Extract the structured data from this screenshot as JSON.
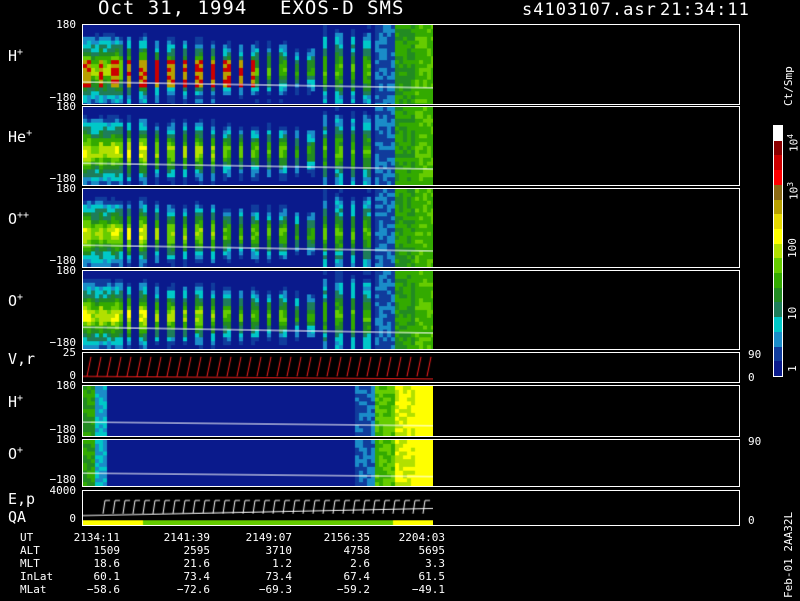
{
  "header": {
    "date": "Oct 31, 1994",
    "instrument": "EXOS-D SMS",
    "file": "s4103107.asr",
    "time": "21:34:11"
  },
  "colorbar": {
    "unit": "Ct/Smp",
    "labels": [
      "10",
      "10",
      "100",
      "10",
      "1"
    ],
    "label_sup": [
      "4",
      "3",
      "",
      "",
      ""
    ],
    "colors": [
      "#ffffff",
      "#8b0000",
      "#cc0000",
      "#ff0000",
      "#8b6914",
      "#b8a000",
      "#e6d800",
      "#ffff00",
      "#b2e000",
      "#66cc00",
      "#33aa00",
      "#228b22",
      "#1e7d5a",
      "#00c8c8",
      "#1a8cc8",
      "#103c9c",
      "#0a1a8c"
    ]
  },
  "panels": [
    {
      "label": "H",
      "sup": "+",
      "ytop": "180",
      "ybot": "−180"
    },
    {
      "label": "He",
      "sup": "+",
      "ytop": "180",
      "ybot": "−180"
    },
    {
      "label": "O",
      "sup": "++",
      "ytop": "180",
      "ybot": "−180"
    },
    {
      "label": "O",
      "sup": "+",
      "ytop": "180",
      "ybot": "−180"
    },
    {
      "label": "V,r",
      "sup": "",
      "ytop": "25",
      "ybot": "0",
      "rtop": "90",
      "rbot": "0"
    },
    {
      "label": "H",
      "sup": "+",
      "ytop": "180",
      "ybot": "−180"
    },
    {
      "label": "O",
      "sup": "+",
      "ytop": "180",
      "ybot": "−180",
      "rtop": "90"
    },
    {
      "label": "E,p",
      "label2": "QA",
      "sup": "",
      "ytop": "4000",
      "ybot": "0",
      "rbot": "0"
    }
  ],
  "table": {
    "rows": [
      {
        "name": "UT",
        "values": [
          "2134:11",
          "2141:39",
          "2149:07",
          "2156:35",
          "2204:03"
        ]
      },
      {
        "name": "ALT",
        "values": [
          "1509",
          "2595",
          "3710",
          "4758",
          "5695"
        ]
      },
      {
        "name": "MLT",
        "values": [
          "18.6",
          "21.6",
          "1.2",
          "2.6",
          "3.3"
        ]
      },
      {
        "name": "InLat",
        "values": [
          "60.1",
          "73.4",
          "73.4",
          "67.4",
          "61.5"
        ]
      },
      {
        "name": "MLat",
        "values": [
          "−58.6",
          "−72.6",
          "−69.3",
          "−59.2",
          "−49.1"
        ]
      }
    ]
  },
  "footer_side": "Feb-01 2AA32L",
  "chart_data": {
    "type": "heatmap",
    "title": "Oct 31, 1994   EXOS-D SMS",
    "x": [
      "2134:11",
      "2141:39",
      "2149:07",
      "2156:35",
      "2204:03"
    ],
    "series": [
      {
        "name": "H+"
      },
      {
        "name": "He+"
      },
      {
        "name": "O++"
      },
      {
        "name": "O+"
      },
      {
        "name": "V,r"
      },
      {
        "name": "H+"
      },
      {
        "name": "O+"
      },
      {
        "name": "E,p"
      }
    ],
    "colorbar_range": [
      1,
      10000
    ],
    "colorbar_unit": "Ct/Smp"
  }
}
